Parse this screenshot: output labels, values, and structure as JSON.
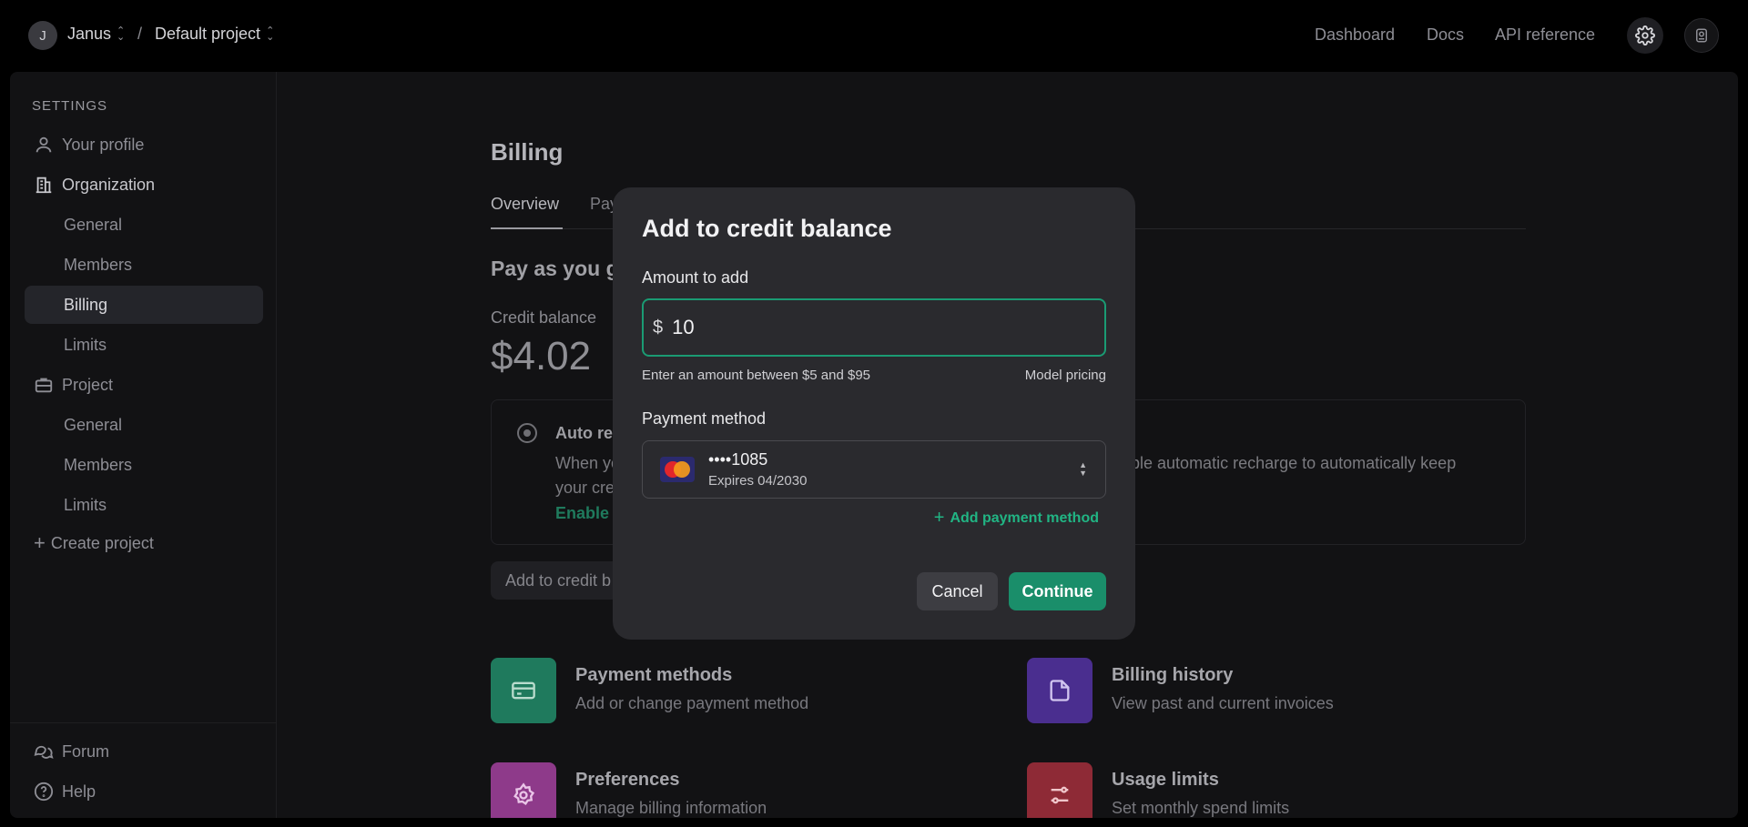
{
  "topbar": {
    "org_initial": "J",
    "org_name": "Janus",
    "separator": "/",
    "project_name": "Default project",
    "links": [
      "Dashboard",
      "Docs",
      "API reference"
    ],
    "settings_icon": "gear-icon",
    "profile_icon": "avatar-icon"
  },
  "sidebar": {
    "heading": "SETTINGS",
    "your_profile": "Your profile",
    "organization": "Organization",
    "org_items": [
      "General",
      "Members",
      "Billing",
      "Limits"
    ],
    "project": "Project",
    "project_items": [
      "General",
      "Members",
      "Limits"
    ],
    "create_project": "Create project",
    "forum": "Forum",
    "help": "Help",
    "active_item": "Billing"
  },
  "main": {
    "title": "Billing",
    "tabs": [
      "Overview",
      "Pay"
    ],
    "section_title": "Pay as you g",
    "credit_label": "Credit balance",
    "credit_amount": "$4.02",
    "auto_title": "Auto re",
    "auto_desc_left": "When yo",
    "auto_desc_right": "able automatic recharge to automatically keep",
    "auto_desc_line2": "your cre",
    "auto_link": "Enable a",
    "add_credit_button": "Add to credit b",
    "tiles": [
      {
        "title": "Payment methods",
        "subtitle": "Add or change payment method",
        "icon": "credit-card-icon",
        "color": "#1f7a5d"
      },
      {
        "title": "Billing history",
        "subtitle": "View past and current invoices",
        "icon": "document-icon",
        "color": "#4a2e8f"
      },
      {
        "title": "Preferences",
        "subtitle": "Manage billing information",
        "icon": "gear-icon",
        "color": "#8e3a8a"
      },
      {
        "title": "Usage limits",
        "subtitle": "Set monthly spend limits",
        "icon": "sliders-icon",
        "color": "#8e2a36"
      }
    ]
  },
  "modal": {
    "title": "Add to credit balance",
    "amount_label": "Amount to add",
    "currency": "$",
    "amount_value": "10",
    "hint": "Enter an amount between $5 and $95",
    "pricing_link": "Model pricing",
    "payment_label": "Payment method",
    "card_number": "••••1085",
    "card_expiry": "Expires 04/2030",
    "card_brand": "MasterCard",
    "add_payment": "Add payment method",
    "cancel": "Cancel",
    "continue": "Continue",
    "accent_color": "#1a8e6a"
  }
}
